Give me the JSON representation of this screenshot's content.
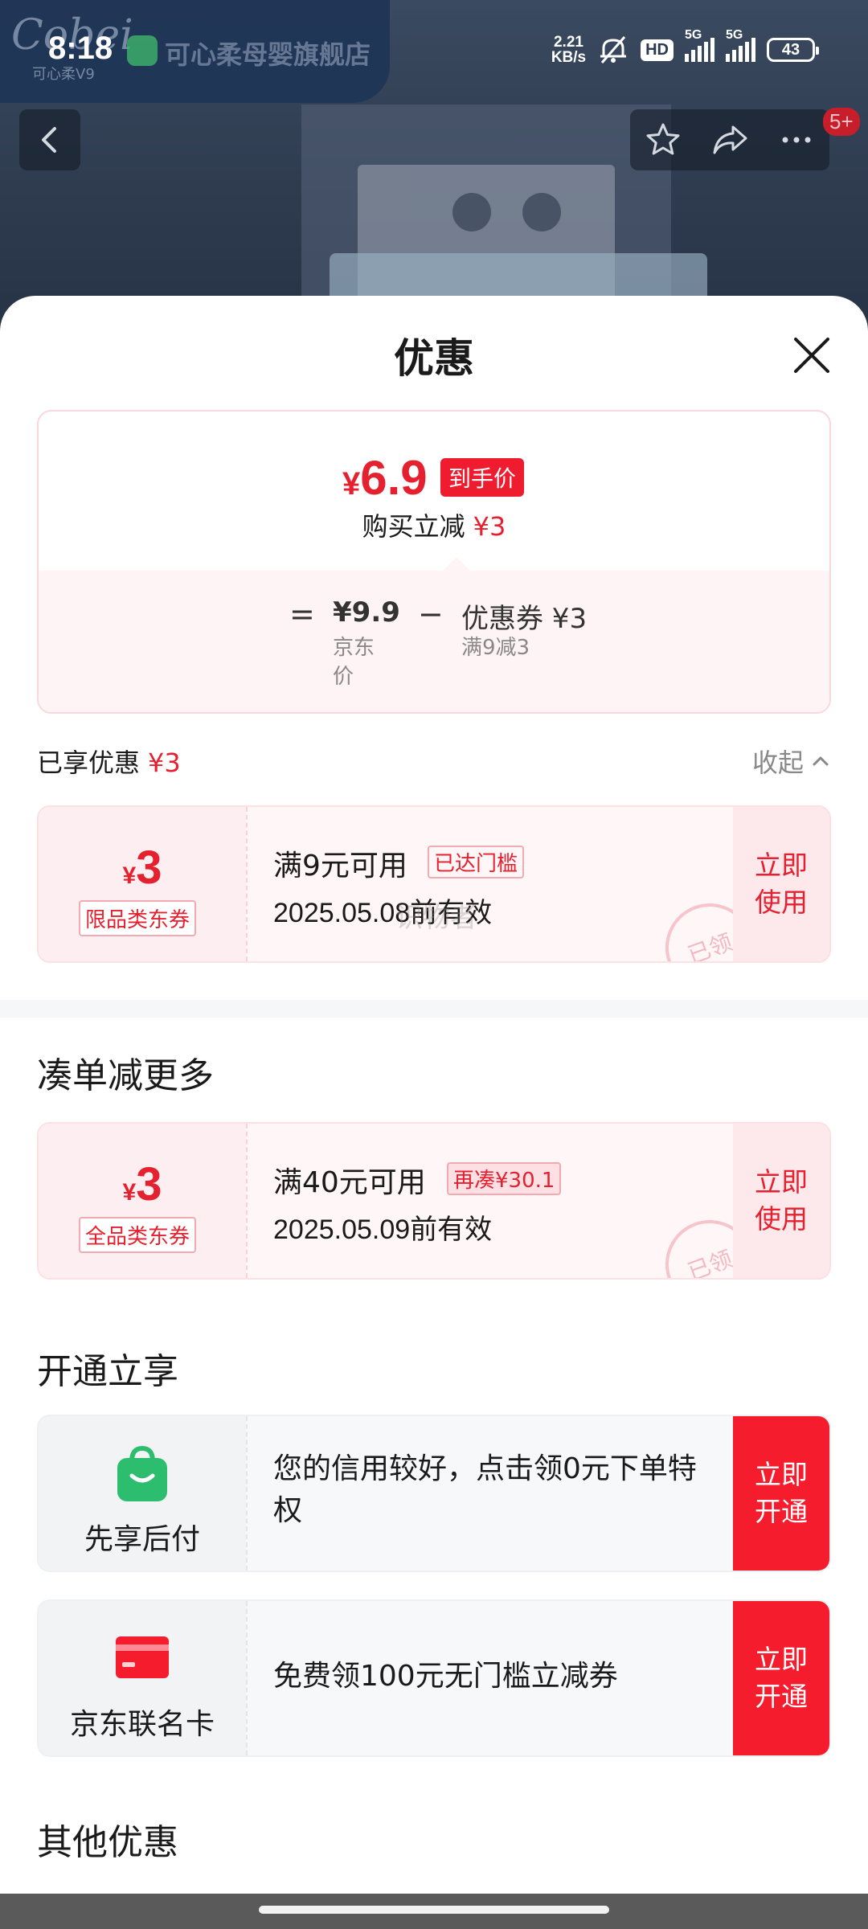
{
  "status_bar": {
    "time": "8:18",
    "net_speed_value": "2.21",
    "net_speed_unit": "KB/s",
    "hd_label": "HD",
    "sim1_label": "5G",
    "sim2_label": "5G",
    "battery": "43"
  },
  "background": {
    "shop_name": "可心柔母婴旗舰店",
    "brand_logo": "Cobei",
    "brand_logo_sub": "可心柔V9",
    "cart_badge": "5+"
  },
  "sheet": {
    "title": "优惠",
    "price_card": {
      "currency": "¥",
      "final_price": "6.9",
      "final_tag": "到手价",
      "reduce_label": "购买立减",
      "reduce_value": "¥3",
      "equals": "=",
      "jd_price": "¥9.9",
      "jd_price_label": "京东价",
      "minus": "−",
      "coupon_label": "优惠券 ¥3",
      "coupon_rule": "满9减3"
    },
    "enjoyed_label": "已享优惠",
    "enjoyed_value": "¥3",
    "collapse_label": "收起",
    "coupons_applied": [
      {
        "currency": "¥",
        "amount": "3",
        "type": "限品类东券",
        "condition": "满9元可用",
        "tag": "已达门槛",
        "valid": "2025.05.08前有效",
        "use_label": "立即使用",
        "stamp": "已领",
        "watermark": "识物者"
      }
    ],
    "more_section_title": "凑单减更多",
    "coupons_more": [
      {
        "currency": "¥",
        "amount": "3",
        "type": "全品类东券",
        "condition": "满40元可用",
        "tag": "再凑¥30.1",
        "valid": "2025.05.09前有效",
        "use_label": "立即使用",
        "stamp": "已领"
      }
    ],
    "open_section_title": "开通立享",
    "open_items": [
      {
        "icon": "shopping-bag-icon",
        "name": "先享后付",
        "desc": "您的信用较好，点击领0元下单特权",
        "button": "立即开通"
      },
      {
        "icon": "credit-card-icon",
        "name": "京东联名卡",
        "desc": "免费领100元无门槛立减券",
        "button": "立即开通"
      }
    ],
    "other_section_title": "其他优惠"
  },
  "colors": {
    "accent_red": "#e5212f",
    "button_red": "#f41c2d",
    "coupon_bg": "#fff6f7",
    "green_icon": "#2dbd6e"
  }
}
